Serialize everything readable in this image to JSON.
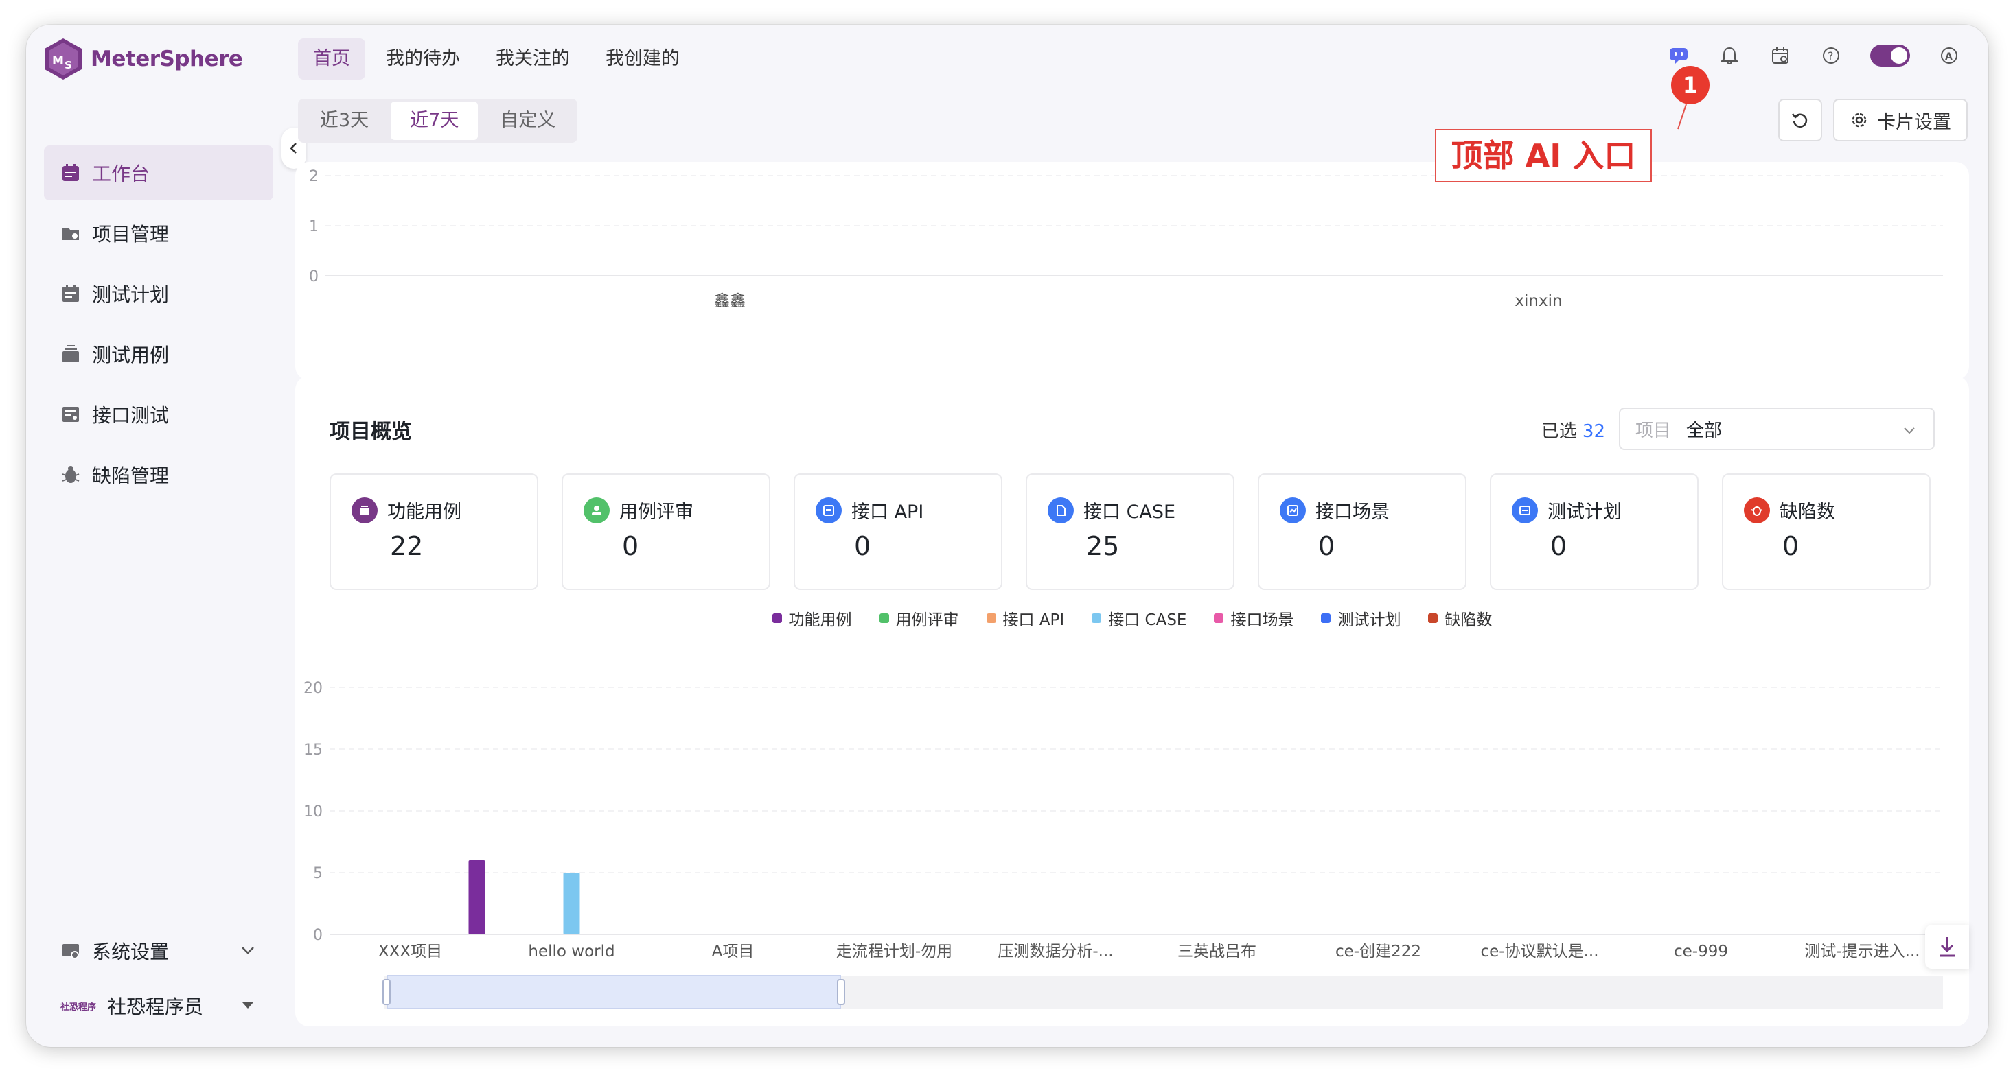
{
  "app": {
    "name": "MeterSphere"
  },
  "topnav": {
    "items": [
      {
        "label": "首页",
        "active": true
      },
      {
        "label": "我的待办",
        "active": false
      },
      {
        "label": "我关注的",
        "active": false
      },
      {
        "label": "我创建的",
        "active": false
      }
    ]
  },
  "top_icons": [
    "ai-chat-icon",
    "bell-icon",
    "calendar-icon",
    "help-icon",
    "theme-toggle",
    "user-settings-icon"
  ],
  "sidebar": {
    "items": [
      {
        "label": "工作台",
        "icon": "workbench-icon",
        "active": true
      },
      {
        "label": "项目管理",
        "icon": "project-icon",
        "active": false
      },
      {
        "label": "测试计划",
        "icon": "plan-icon",
        "active": false
      },
      {
        "label": "测试用例",
        "icon": "case-icon",
        "active": false
      },
      {
        "label": "接口测试",
        "icon": "api-icon",
        "active": false
      },
      {
        "label": "缺陷管理",
        "icon": "bug-icon",
        "active": false
      }
    ],
    "settings_label": "系统设置",
    "user_tag": "社恐程序",
    "user_name": "社恐程序员"
  },
  "range": {
    "options": [
      "近3天",
      "近7天",
      "自定义"
    ],
    "selected": "近7天"
  },
  "toolbar": {
    "card_settings_label": "卡片设置"
  },
  "annotation": {
    "label": "顶部 AI 入口",
    "marker": "1"
  },
  "top_chart": {
    "type": "bar",
    "categories": [
      "鑫鑫",
      "xinxin"
    ],
    "y_ticks": [
      "2",
      "1",
      "0"
    ],
    "ylim": [
      0,
      2
    ]
  },
  "overview": {
    "title": "项目概览",
    "selected_label": "已选",
    "selected_count": "32",
    "select_prefix": "项目",
    "select_value": "全部",
    "stats": [
      {
        "label": "功能用例",
        "value": "22",
        "color": "#783887",
        "icon": "case-stat-icon"
      },
      {
        "label": "用例评审",
        "value": "0",
        "color": "#52c16a",
        "icon": "review-stat-icon"
      },
      {
        "label": "接口 API",
        "value": "0",
        "color": "#3d78f5",
        "icon": "api-stat-icon"
      },
      {
        "label": "接口 CASE",
        "value": "25",
        "color": "#3d78f5",
        "icon": "case-file-stat-icon"
      },
      {
        "label": "接口场景",
        "value": "0",
        "color": "#3d78f5",
        "icon": "scenario-stat-icon"
      },
      {
        "label": "测试计划",
        "value": "0",
        "color": "#3d78f5",
        "icon": "plan-stat-icon"
      },
      {
        "label": "缺陷数",
        "value": "0",
        "color": "#e03b2b",
        "icon": "bug-stat-icon"
      }
    ]
  },
  "chart_data": {
    "type": "bar",
    "categories": [
      "XXX项目",
      "hello world",
      "A项目",
      "走流程计划-勿用",
      "压测数据分析-...",
      "三英战吕布",
      "ce-创建222",
      "ce-协议默认是...",
      "ce-999",
      "测试-提示进入..."
    ],
    "series": [
      {
        "name": "功能用例",
        "color": "#7a2d9c",
        "values": [
          0,
          6,
          0,
          0,
          0,
          0,
          0,
          0,
          0,
          0
        ]
      },
      {
        "name": "用例评审",
        "color": "#52c16a",
        "values": [
          0,
          0,
          0,
          0,
          0,
          0,
          0,
          0,
          0,
          0
        ]
      },
      {
        "name": "接口 API",
        "color": "#f3a06b",
        "values": [
          0,
          0,
          0,
          0,
          0,
          0,
          0,
          0,
          0,
          0
        ]
      },
      {
        "name": "接口 CASE",
        "color": "#7cc7f0",
        "values": [
          0,
          5,
          0,
          0,
          0,
          0,
          0,
          0,
          0,
          0
        ]
      },
      {
        "name": "接口场景",
        "color": "#e85aa8",
        "values": [
          0,
          0,
          0,
          0,
          0,
          0,
          0,
          0,
          0,
          0
        ]
      },
      {
        "name": "测试计划",
        "color": "#3d6ff5",
        "values": [
          0,
          0,
          0,
          0,
          0,
          0,
          0,
          0,
          0,
          0
        ]
      },
      {
        "name": "缺陷数",
        "color": "#c9472b",
        "values": [
          0,
          0,
          0,
          0,
          0,
          0,
          0,
          0,
          0,
          0
        ]
      }
    ],
    "y_ticks": [
      "20",
      "15",
      "10",
      "5",
      "0"
    ],
    "ylim": [
      0,
      20
    ],
    "legend": "top-center",
    "grid": true
  }
}
